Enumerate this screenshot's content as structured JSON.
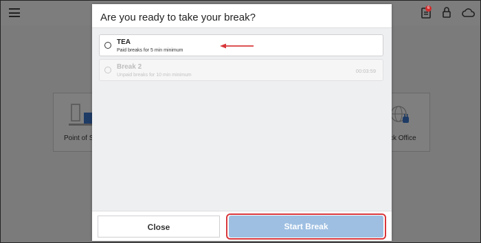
{
  "background": {
    "notification_badge": "6",
    "tiles": [
      {
        "label": "Point of S"
      },
      {
        "label": "ck Office"
      }
    ]
  },
  "modal": {
    "title": "Are you ready to take your break?",
    "options": [
      {
        "name": "TEA",
        "description": "Paid breaks for 5 min minimum",
        "time": "",
        "enabled": true
      },
      {
        "name": "Break 2",
        "description": "Unpaid breaks for 10 min minimum",
        "time": "00:03:59",
        "enabled": false
      }
    ],
    "close_label": "Close",
    "start_label": "Start Break"
  },
  "colors": {
    "accent": "#9ebfe2",
    "highlight": "#d8363a"
  }
}
